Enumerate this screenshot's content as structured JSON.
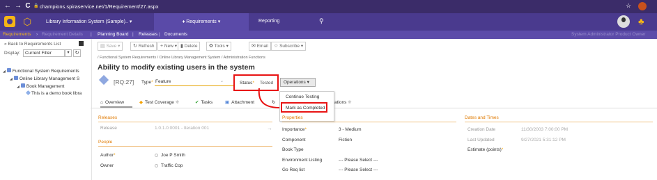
{
  "browser": {
    "back": "←",
    "forward": "→",
    "reload": "C",
    "lock": "🔒",
    "url": "champions.spiraservice.net/1/Requirement/27.aspx",
    "star": "☆"
  },
  "header": {
    "product_name": "Library Information System (Sample)..",
    "product_caret": "▾",
    "nav_requirements": "♦  Requirements ▾",
    "nav_reporting": "Reporting",
    "search_glyph": "⚲",
    "notification_glyph": "♣"
  },
  "subnav": {
    "requirements": "Requirements",
    "separator": "›",
    "requirement_details": "Requirement Details",
    "planning_board": "Planning Board",
    "releases": "Releases",
    "documents": "Documents",
    "user_info": "System Administrator  Product Owner"
  },
  "left": {
    "back_link": "« Back to Requirements List",
    "display_label": "Display:",
    "filter_value": "Current Filter",
    "filter_caret": "▾",
    "refresh_glyph": "↻",
    "tree": [
      {
        "label": "Functional System Requirements"
      },
      {
        "label": "Online Library Management S"
      },
      {
        "label": "Book Management"
      },
      {
        "label": "This is a demo book libra"
      }
    ],
    "tree_caret": "◢"
  },
  "toolbar": {
    "save": "Save",
    "refresh": "Refresh",
    "new": "New",
    "delete": "Delete",
    "tools": "Tools",
    "email": "Email",
    "subscribe": "Subscribe",
    "caret": "▾"
  },
  "breadcrumb": "/ Functional System Requirements / Online Library Management System / Administration Functions",
  "title": "Ability to modify existing users in the system",
  "req": {
    "token": "[RQ:27]",
    "type_label": "Type",
    "type_value": "Feature",
    "status_label": "Status",
    "status_value": "Tested",
    "operations": "Operations ▾",
    "required_marker": "*"
  },
  "operations_menu": {
    "items": [
      "Continue Testing",
      "Mark as Completed"
    ]
  },
  "tabs": [
    {
      "label": "Overview",
      "icon": "⌂"
    },
    {
      "label": "Test Coverage",
      "icon": "◆",
      "extra": "❋"
    },
    {
      "label": "Tasks",
      "icon": "✔"
    },
    {
      "label": "Attachment",
      "icon": "▣"
    },
    {
      "label": "ations",
      "icon": "",
      "extra": "❋"
    }
  ],
  "tab_partial_icon": "↻",
  "releases": {
    "title": "Releases",
    "release_label": "Release",
    "release_value": "1.0.1.0.0001 - Iteration 001",
    "arrow": "→"
  },
  "people": {
    "title": "People",
    "author_label": "Author",
    "author_value": "Joe P Smith",
    "owner_label": "Owner",
    "owner_value": "Traffic Cop"
  },
  "properties": {
    "title": "Properties",
    "importance_label": "Importance",
    "importance_value": "3 - Medium",
    "component_label": "Component",
    "component_value": "Fiction",
    "booktype_label": "Book Type",
    "environment_label": "Environment Listing",
    "environment_value": "--- Please Select ---",
    "goreq_label": "Go Req list",
    "goreq_value": "--- Please Select ---"
  },
  "dates": {
    "title": "Dates and Times",
    "creation_label": "Creation Date",
    "creation_value": "11/30/2003 7:00:00 PM",
    "updated_label": "Last Updated",
    "updated_value": "9/27/2021 5:31:12 PM",
    "estimate_label": "Estimate (points)"
  },
  "colors": {
    "browser_bar": "#3b2c69",
    "header": "#4a3a8e",
    "accent_orange": "#e07a00",
    "highlight_red": "#e81313",
    "logo_yellow": "#f5b516"
  }
}
